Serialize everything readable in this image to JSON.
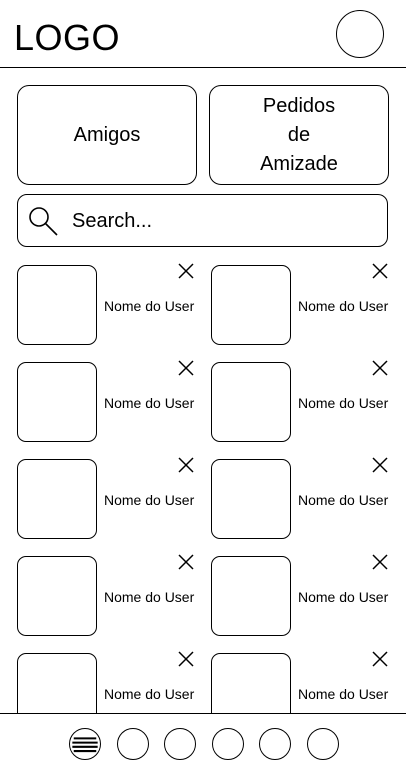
{
  "header": {
    "logo": "LOGO",
    "profile_icon": "profile-circle-icon"
  },
  "tabs": [
    {
      "label": "Amigos"
    },
    {
      "label": "Pedidos\nde\nAmizade"
    }
  ],
  "search": {
    "placeholder": "Search...",
    "icon": "search-icon"
  },
  "friends": [
    {
      "name": "Nome do User"
    },
    {
      "name": "Nome do User"
    },
    {
      "name": "Nome do User"
    },
    {
      "name": "Nome do User"
    },
    {
      "name": "Nome do User"
    },
    {
      "name": "Nome do User"
    },
    {
      "name": "Nome do User"
    },
    {
      "name": "Nome do User"
    },
    {
      "name": "Nome do User"
    },
    {
      "name": "Nome do User"
    }
  ],
  "bottom_nav": [
    {
      "icon": "menu-icon"
    },
    {
      "icon": "nav-circle-icon"
    },
    {
      "icon": "nav-circle-icon"
    },
    {
      "icon": "nav-circle-icon"
    },
    {
      "icon": "nav-circle-icon"
    },
    {
      "icon": "nav-circle-icon"
    }
  ]
}
